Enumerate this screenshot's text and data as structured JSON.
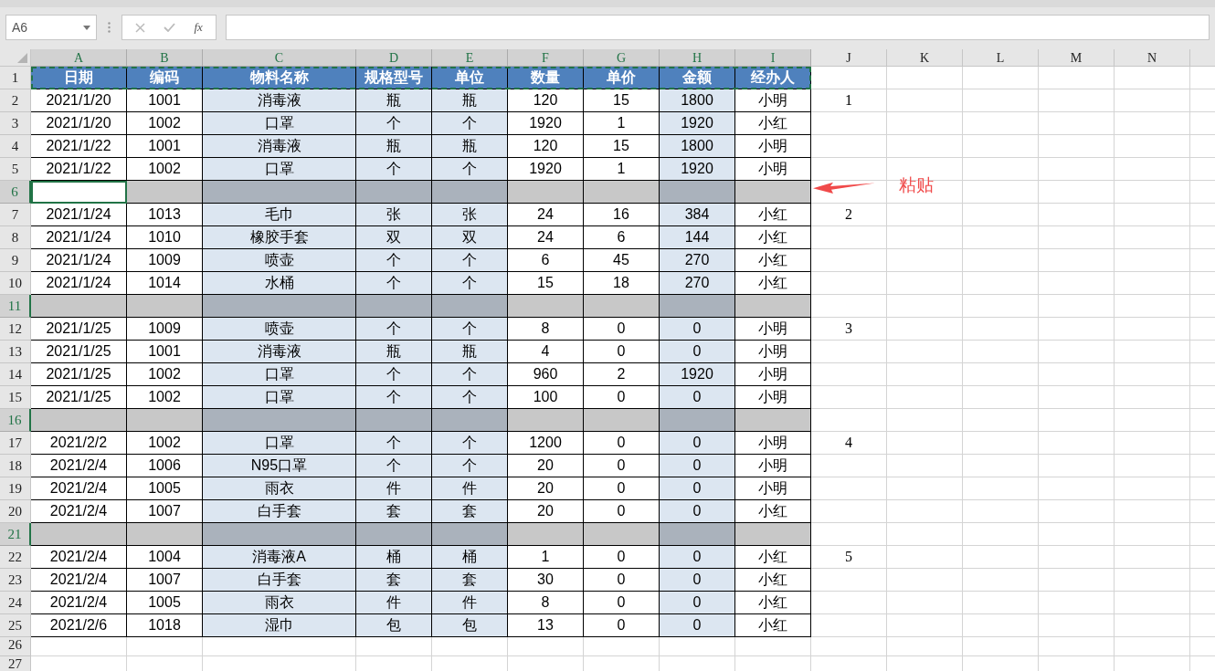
{
  "name_box": "A6",
  "function_label": "fx",
  "columns": [
    {
      "letter": "A",
      "selected": true,
      "shaded": false
    },
    {
      "letter": "B",
      "selected": true,
      "shaded": false
    },
    {
      "letter": "C",
      "selected": true,
      "shaded": true
    },
    {
      "letter": "D",
      "selected": true,
      "shaded": true
    },
    {
      "letter": "E",
      "selected": true,
      "shaded": true
    },
    {
      "letter": "F",
      "selected": true,
      "shaded": false
    },
    {
      "letter": "G",
      "selected": true,
      "shaded": false
    },
    {
      "letter": "H",
      "selected": true,
      "shaded": true
    },
    {
      "letter": "I",
      "selected": true,
      "shaded": false
    },
    {
      "letter": "J",
      "selected": false
    },
    {
      "letter": "K",
      "selected": false
    },
    {
      "letter": "L",
      "selected": false
    },
    {
      "letter": "M",
      "selected": false
    },
    {
      "letter": "N",
      "selected": false
    }
  ],
  "rows": [
    {
      "number": "1",
      "kind": "header",
      "selected": false,
      "copy_marquee": true,
      "cells": [
        "日期",
        "编码",
        "物料名称",
        "规格型号",
        "单位",
        "数量",
        "单价",
        "金额",
        "经办人"
      ]
    },
    {
      "number": "2",
      "kind": "data",
      "selected": false,
      "cells": [
        "2021/1/20",
        "1001",
        "消毒液",
        "瓶",
        "瓶",
        "120",
        "15",
        "1800",
        "小明"
      ],
      "marker": "1"
    },
    {
      "number": "3",
      "kind": "data",
      "selected": false,
      "cells": [
        "2021/1/20",
        "1002",
        "口罩",
        "个",
        "个",
        "1920",
        "1",
        "1920",
        "小红"
      ]
    },
    {
      "number": "4",
      "kind": "data",
      "selected": false,
      "cells": [
        "2021/1/22",
        "1001",
        "消毒液",
        "瓶",
        "瓶",
        "120",
        "15",
        "1800",
        "小明"
      ]
    },
    {
      "number": "5",
      "kind": "data",
      "selected": false,
      "cells": [
        "2021/1/22",
        "1002",
        "口罩",
        "个",
        "个",
        "1920",
        "1",
        "1920",
        "小明"
      ]
    },
    {
      "number": "6",
      "kind": "separator",
      "selected": true,
      "active": true
    },
    {
      "number": "7",
      "kind": "data",
      "selected": false,
      "cells": [
        "2021/1/24",
        "1013",
        "毛巾",
        "张",
        "张",
        "24",
        "16",
        "384",
        "小红"
      ],
      "marker": "2"
    },
    {
      "number": "8",
      "kind": "data",
      "selected": false,
      "cells": [
        "2021/1/24",
        "1010",
        "橡胶手套",
        "双",
        "双",
        "24",
        "6",
        "144",
        "小红"
      ]
    },
    {
      "number": "9",
      "kind": "data",
      "selected": false,
      "cells": [
        "2021/1/24",
        "1009",
        "喷壶",
        "个",
        "个",
        "6",
        "45",
        "270",
        "小红"
      ]
    },
    {
      "number": "10",
      "kind": "data",
      "selected": false,
      "cells": [
        "2021/1/24",
        "1014",
        "水桶",
        "个",
        "个",
        "15",
        "18",
        "270",
        "小红"
      ]
    },
    {
      "number": "11",
      "kind": "separator",
      "selected": true,
      "active": false
    },
    {
      "number": "12",
      "kind": "data",
      "selected": false,
      "cells": [
        "2021/1/25",
        "1009",
        "喷壶",
        "个",
        "个",
        "8",
        "0",
        "0",
        "小明"
      ],
      "marker": "3"
    },
    {
      "number": "13",
      "kind": "data",
      "selected": false,
      "cells": [
        "2021/1/25",
        "1001",
        "消毒液",
        "瓶",
        "瓶",
        "4",
        "0",
        "0",
        "小明"
      ]
    },
    {
      "number": "14",
      "kind": "data",
      "selected": false,
      "cells": [
        "2021/1/25",
        "1002",
        "口罩",
        "个",
        "个",
        "960",
        "2",
        "1920",
        "小明"
      ]
    },
    {
      "number": "15",
      "kind": "data",
      "selected": false,
      "cells": [
        "2021/1/25",
        "1002",
        "口罩",
        "个",
        "个",
        "100",
        "0",
        "0",
        "小明"
      ]
    },
    {
      "number": "16",
      "kind": "separator",
      "selected": true,
      "active": false
    },
    {
      "number": "17",
      "kind": "data",
      "selected": false,
      "cells": [
        "2021/2/2",
        "1002",
        "口罩",
        "个",
        "个",
        "1200",
        "0",
        "0",
        "小明"
      ],
      "marker": "4"
    },
    {
      "number": "18",
      "kind": "data",
      "selected": false,
      "cells": [
        "2021/2/4",
        "1006",
        "N95口罩",
        "个",
        "个",
        "20",
        "0",
        "0",
        "小明"
      ]
    },
    {
      "number": "19",
      "kind": "data",
      "selected": false,
      "cells": [
        "2021/2/4",
        "1005",
        "雨衣",
        "件",
        "件",
        "20",
        "0",
        "0",
        "小明"
      ]
    },
    {
      "number": "20",
      "kind": "data",
      "selected": false,
      "cells": [
        "2021/2/4",
        "1007",
        "白手套",
        "套",
        "套",
        "20",
        "0",
        "0",
        "小红"
      ]
    },
    {
      "number": "21",
      "kind": "separator",
      "selected": true,
      "active": false
    },
    {
      "number": "22",
      "kind": "data",
      "selected": false,
      "cells": [
        "2021/2/4",
        "1004",
        "消毒液A",
        "桶",
        "桶",
        "1",
        "0",
        "0",
        "小红"
      ],
      "marker": "5"
    },
    {
      "number": "23",
      "kind": "data",
      "selected": false,
      "cells": [
        "2021/2/4",
        "1007",
        "白手套",
        "套",
        "套",
        "30",
        "0",
        "0",
        "小红"
      ]
    },
    {
      "number": "24",
      "kind": "data",
      "selected": false,
      "cells": [
        "2021/2/4",
        "1005",
        "雨衣",
        "件",
        "件",
        "8",
        "0",
        "0",
        "小红"
      ]
    },
    {
      "number": "25",
      "kind": "data",
      "selected": false,
      "cells": [
        "2021/2/6",
        "1018",
        "湿巾",
        "包",
        "包",
        "13",
        "0",
        "0",
        "小红"
      ]
    },
    {
      "number": "26",
      "kind": "empty",
      "selected": false
    },
    {
      "number": "27",
      "kind": "empty",
      "selected": false
    }
  ],
  "annotation": {
    "label": "粘贴"
  }
}
